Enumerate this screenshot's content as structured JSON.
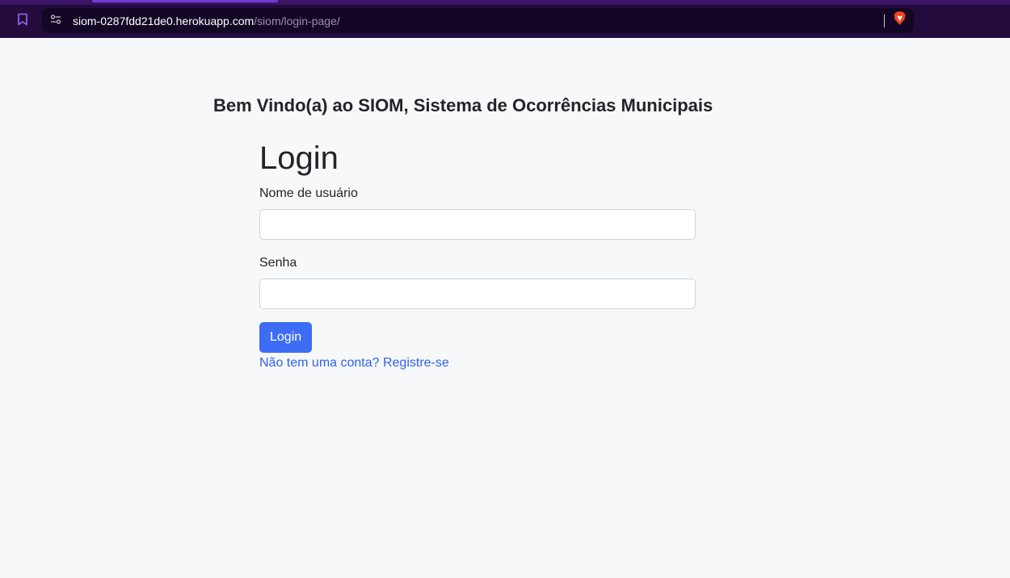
{
  "browser": {
    "url_host": "siom-0287fdd21de0.herokuapp.com",
    "url_path": "/siom/login-page/",
    "icons": [
      "bookmark-icon",
      "site-settings-icon",
      "brave-shield-icon"
    ],
    "colors": {
      "chrome_bg": "#230b3d",
      "address_bg": "#140726",
      "accent": "#6d3bd1"
    }
  },
  "page": {
    "welcome_heading": "Bem Vindo(a) ao SIOM, Sistema de Ocorrências Municipais",
    "login_title": "Login",
    "username_label": "Nome de usuário",
    "username_value": "",
    "password_label": "Senha",
    "password_value": "",
    "login_button": "Login",
    "register_link": "Não tem uma conta? Registre-se",
    "colors": {
      "button": "#3d6cf5",
      "link": "#2f62ea",
      "background": "#f7f8fa"
    }
  }
}
